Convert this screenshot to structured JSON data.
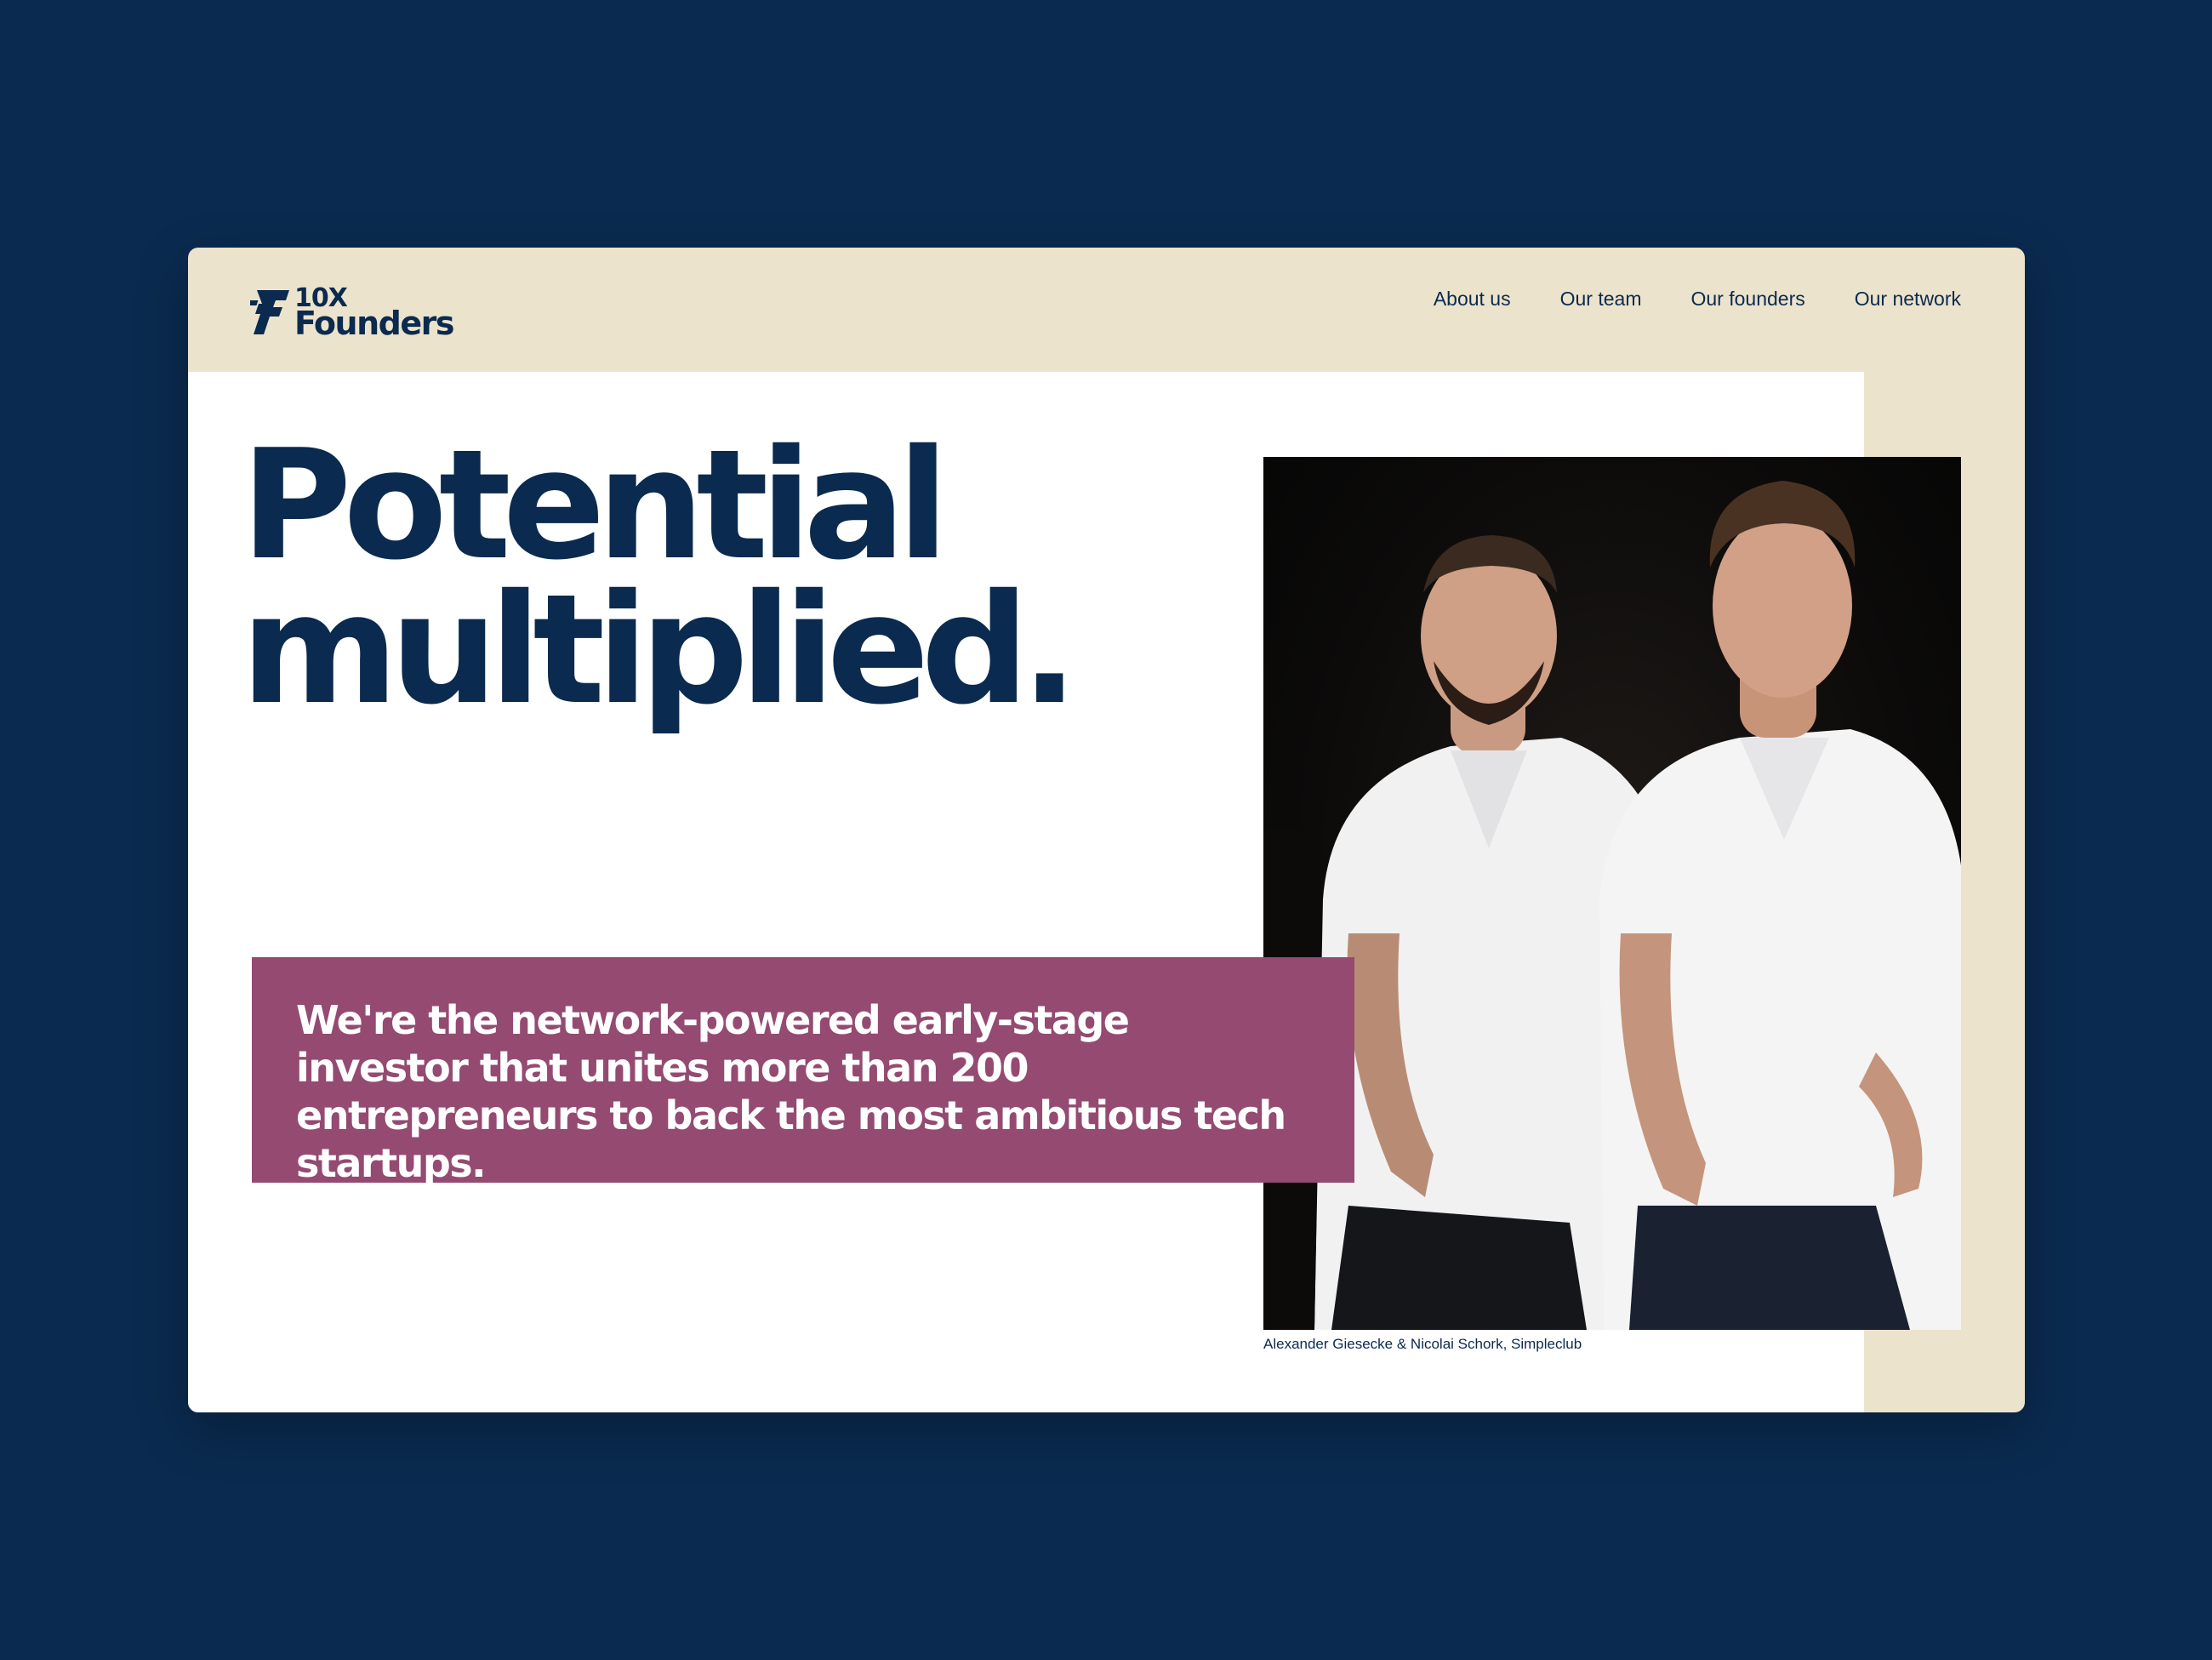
{
  "brand": {
    "logo_line1": "10X",
    "logo_line2": "Founders"
  },
  "nav": {
    "items": [
      {
        "label": "About us"
      },
      {
        "label": "Our team"
      },
      {
        "label": "Our founders"
      },
      {
        "label": "Our network"
      }
    ]
  },
  "hero": {
    "headline_line1": "Potential",
    "headline_line2": "multiplied.",
    "tagline": "We're the network-powered early-stage investor that unites more than 200 entrepreneurs to back the most ambitious tech startups.",
    "photo_caption": "Alexander Giesecke & Nicolai Schork, Simpleclub"
  },
  "colors": {
    "background": "#0a2a4f",
    "header": "#ece3cc",
    "tagline_box": "#944a71",
    "text_primary": "#0a2a4f"
  }
}
